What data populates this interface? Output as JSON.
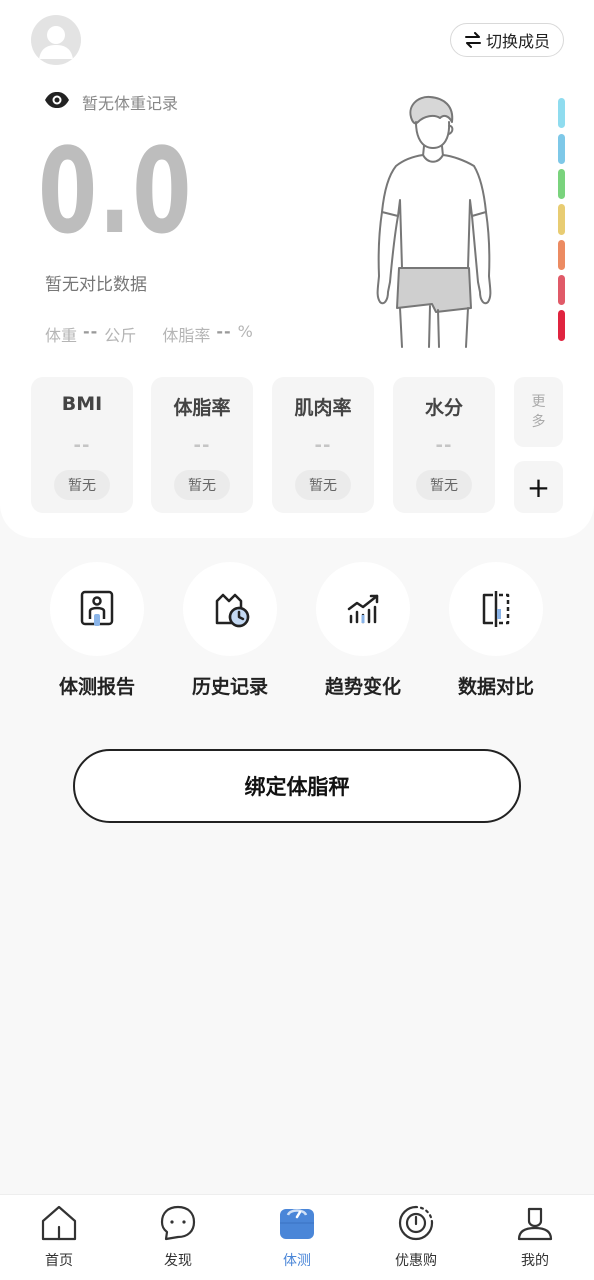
{
  "header": {
    "avatar_icon": "user-avatar-icon",
    "switch_member_label": "切换成员",
    "switch_icon": "swap-arrows-icon"
  },
  "weight_panel": {
    "visibility_icon": "eye-icon",
    "status_text": "暂无体重记录",
    "value": "0.0",
    "compare_text": "暂无对比数据",
    "weight_label": "体重",
    "weight_value": "--",
    "weight_unit": "公斤",
    "bodyfat_label": "体脂率",
    "bodyfat_value": "--",
    "bodyfat_unit": "%",
    "body_figure_icon": "male-body-outline-icon",
    "scale_colors": [
      "#8fdcef",
      "#7ec8e8",
      "#7ad37d",
      "#e8cc72",
      "#ec8b62",
      "#e05a68",
      "#e0243f"
    ]
  },
  "metrics": [
    {
      "title": "BMI",
      "value": "--",
      "status": "暂无"
    },
    {
      "title": "体脂率",
      "value": "--",
      "status": "暂无"
    },
    {
      "title": "肌肉率",
      "value": "--",
      "status": "暂无"
    },
    {
      "title": "水分",
      "value": "--",
      "status": "暂无"
    }
  ],
  "more_label_1": "更",
  "more_label_2": "多",
  "add_label": "+",
  "functions": [
    {
      "label": "体测报告",
      "icon": "body-report-icon"
    },
    {
      "label": "历史记录",
      "icon": "history-icon"
    },
    {
      "label": "趋势变化",
      "icon": "trend-chart-icon"
    },
    {
      "label": "数据对比",
      "icon": "compare-icon"
    }
  ],
  "bind_button_label": "绑定体脂秤",
  "tabbar": {
    "active_color": "#4a86d8",
    "tabs": [
      {
        "label": "首页",
        "icon": "home-icon"
      },
      {
        "label": "发现",
        "icon": "chat-bubble-icon"
      },
      {
        "label": "体测",
        "icon": "scale-icon"
      },
      {
        "label": "优惠购",
        "icon": "coupon-icon"
      },
      {
        "label": "我的",
        "icon": "profile-icon"
      }
    ]
  }
}
